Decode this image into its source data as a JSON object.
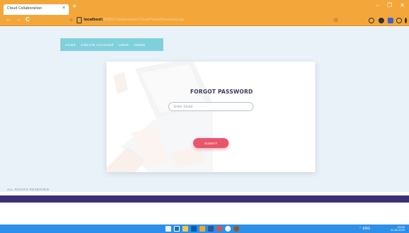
{
  "browser": {
    "tab_title": "Cloud Collaboration",
    "tab_close": "×",
    "new_tab": "+",
    "window_controls": {
      "minimize": "–",
      "maximize": "❐",
      "close": "✕"
    },
    "url_host": "localhost:",
    "url_rest": "8080/Collaborative-Cloud/ForgotPassword.jsp",
    "nav": {
      "back": "←",
      "forward": "→",
      "reload": "C"
    },
    "bookmark_star": "☆"
  },
  "navbar": {
    "items": [
      {
        "label": "HOME"
      },
      {
        "label": "CREATE ACCOUNT"
      },
      {
        "label": "USER"
      },
      {
        "label": "ADMIN"
      }
    ]
  },
  "form": {
    "title": "FORGOT PASSWORD",
    "email_placeholder": "Enter Email",
    "email_value": "",
    "submit_label": "SUBMIT"
  },
  "footer": {
    "text": "ALL RIGHTS RESERVED"
  },
  "taskbar": {
    "lang": "ENG",
    "region": "IN",
    "time": "03:30",
    "date": "11-08-2023"
  },
  "colors": {
    "browser_chrome": "#f3a73b",
    "navbar": "#7fd0dc",
    "page_bg": "#e9f2f8",
    "title": "#3d3a5c",
    "submit": "#e8566b",
    "footer_bar": "#3c2e74",
    "taskbar": "#2d8fe8"
  }
}
